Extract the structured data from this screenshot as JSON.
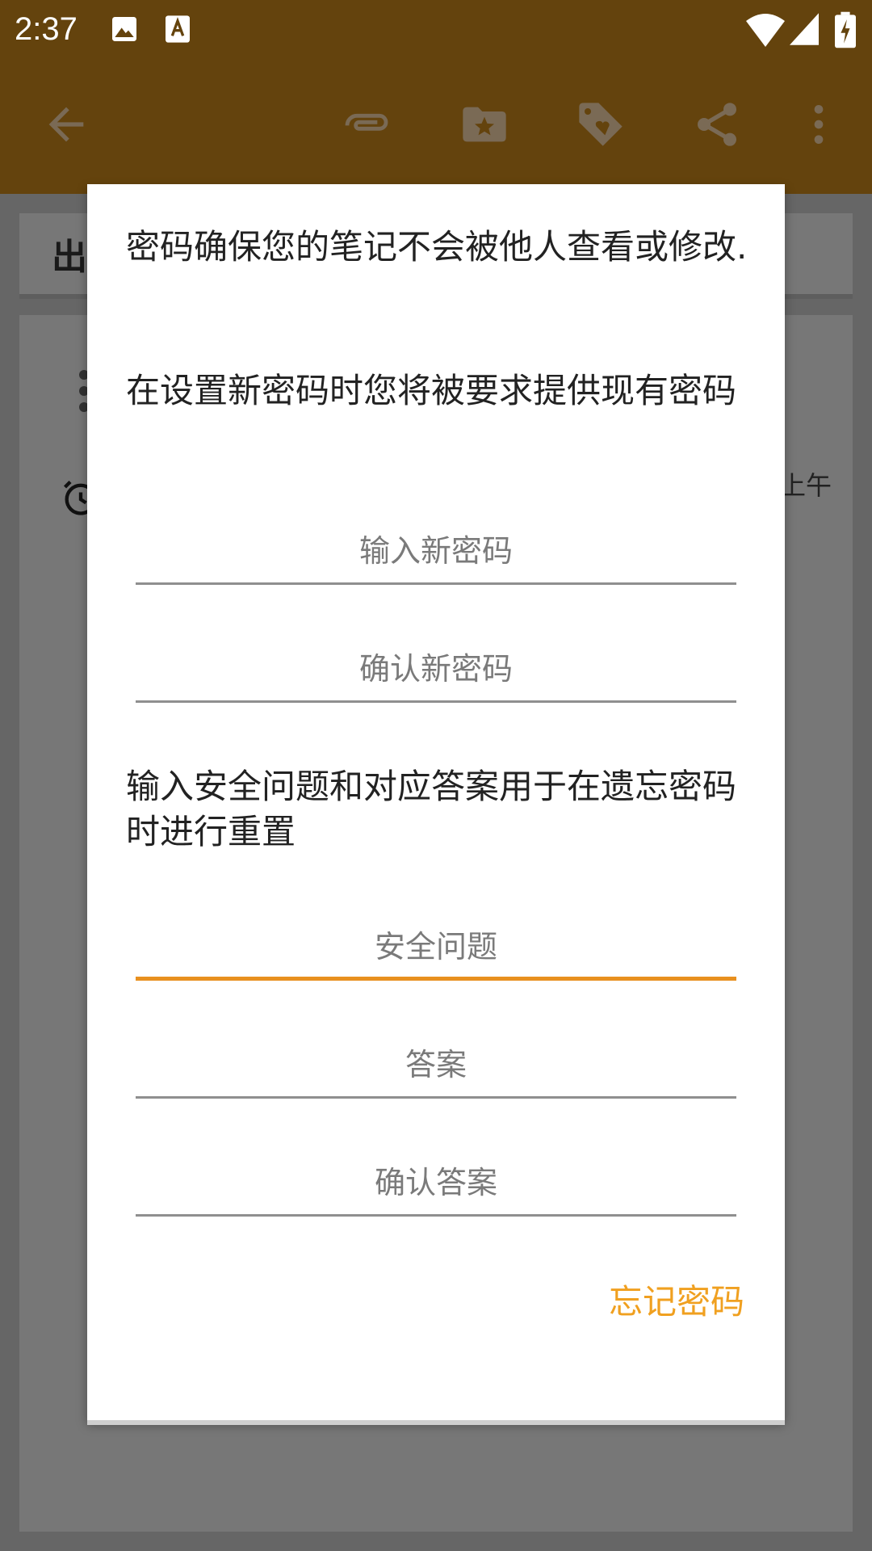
{
  "status_bar": {
    "time": "2:37",
    "icons": [
      "image-icon",
      "text-a-icon",
      "wifi-icon",
      "signal-icon",
      "battery-charging-icon"
    ]
  },
  "toolbar": {
    "icons": [
      "back-arrow-icon",
      "attachment-icon",
      "folder-star-icon",
      "tag-heart-icon",
      "share-icon",
      "more-vert-icon"
    ]
  },
  "background": {
    "note_title": "出",
    "time_fragment": "上午"
  },
  "dialog": {
    "intro": "密码确保您的笔记不会被他人查看或修改.",
    "existing_note": "在设置新密码时您将被要求提供现有密码",
    "new_password_placeholder": "输入新密码",
    "confirm_password_placeholder": "确认新密码",
    "security_note": "输入安全问题和对应答案用于在遗忘密码时进行重置",
    "security_question_placeholder": "安全问题",
    "answer_placeholder": "答案",
    "confirm_answer_placeholder": "确认答案",
    "forgot_password": "忘记密码"
  },
  "colors": {
    "toolbar": "#64430d",
    "accent": "#f0a020",
    "focus_line": "#e8901f"
  }
}
